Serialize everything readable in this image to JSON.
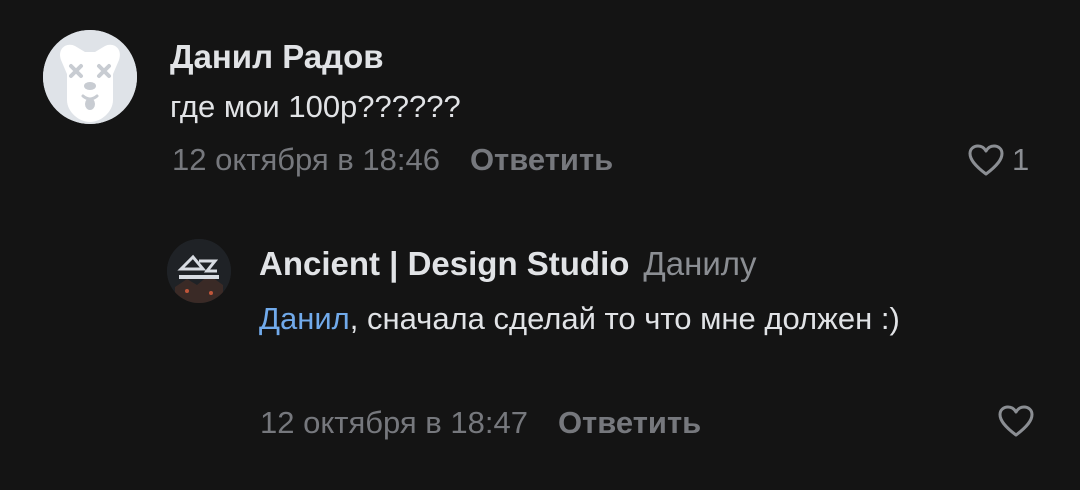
{
  "comments": [
    {
      "author": "Данил Радов",
      "text": "где мои 100р??????",
      "timestamp": "12 октября в 18:46",
      "reply_label": "Ответить",
      "likes": "1",
      "avatar_icon": "sad-dog-icon"
    },
    {
      "author": "Ancient | Design Studio",
      "reply_to": "Данилу",
      "mention": "Данил",
      "text": ", сначала сделай то что мне должен :)",
      "timestamp": "12 октября в 18:47",
      "reply_label": "Ответить",
      "avatar_icon": "studio-logo-icon"
    }
  ],
  "colors": {
    "background": "#141414",
    "author": "#e1e3e6",
    "meta": "#76787d",
    "mention": "#71aaeb"
  }
}
